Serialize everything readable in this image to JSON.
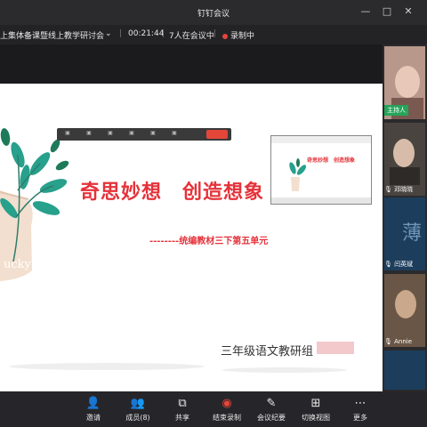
{
  "window": {
    "title": "钉钉会议"
  },
  "meeting": {
    "title": "上集体备课暨线上教学研讨会",
    "elapsed": "00:21:44",
    "participants": "7人在会议中",
    "recording": "录制中"
  },
  "slide": {
    "title": "奇思妙想　创造想象",
    "subtitle": "--------统编教材三下第五单元",
    "group": "三年级语文教研组",
    "pot_text": "ucky"
  },
  "thumbnail": {
    "title": "奇思妙想　创造想象"
  },
  "participants": [
    {
      "name": "主持人",
      "badge": true
    },
    {
      "name": "邓晓晓"
    },
    {
      "name": "闫英斌"
    },
    {
      "name": "Annie"
    }
  ],
  "toolbar": {
    "invite": "邀请",
    "members": "成员(8)",
    "share": "共享",
    "end_record": "结束录制",
    "minutes": "会议纪要",
    "switch_view": "切换视图",
    "more": "更多"
  },
  "colors": {
    "accent_red": "#e5323a",
    "record_red": "#e5463a",
    "host_green": "#26a55a"
  }
}
